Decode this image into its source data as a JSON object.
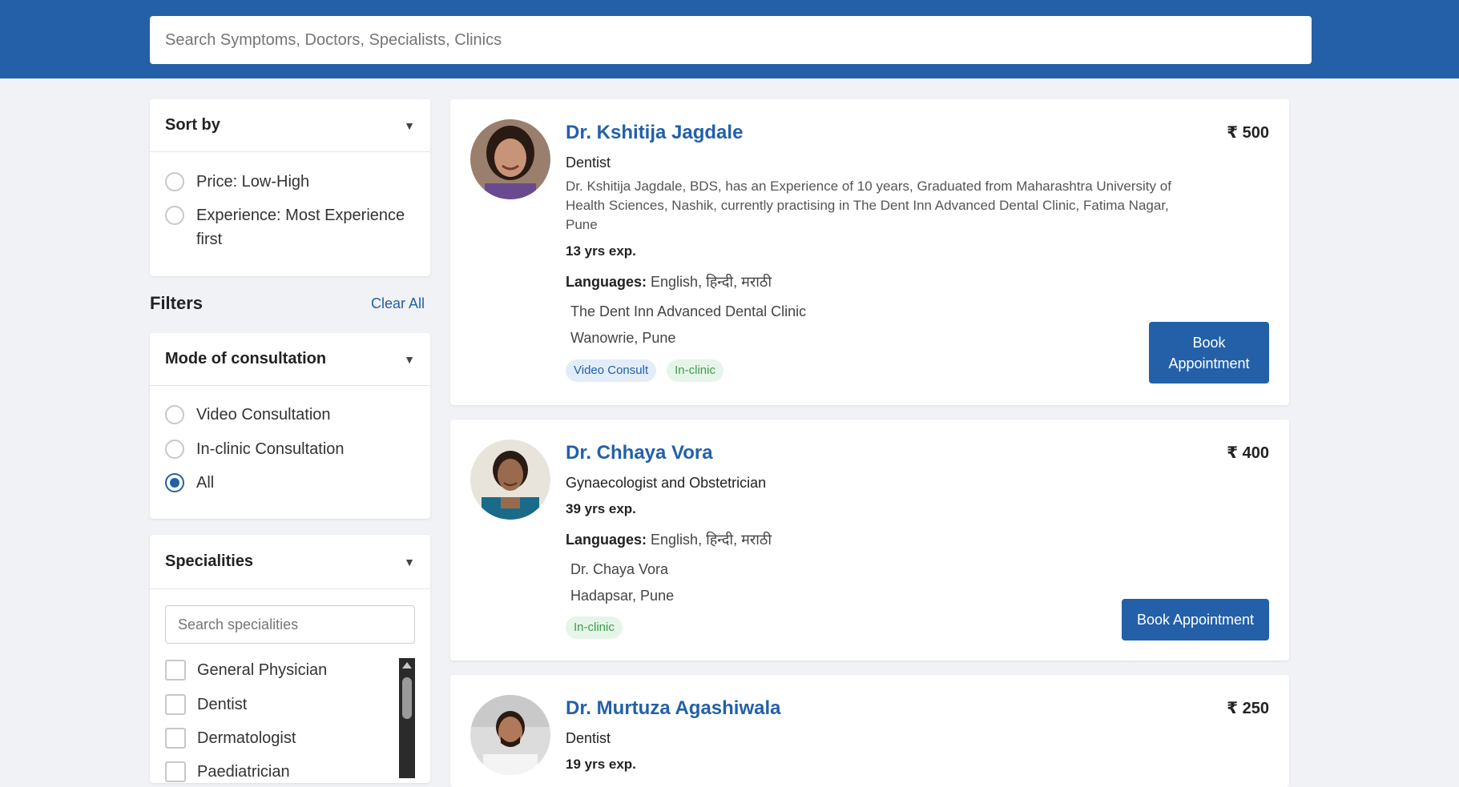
{
  "header": {
    "search_placeholder": "Search Symptoms, Doctors, Specialists, Clinics"
  },
  "sort": {
    "title": "Sort by",
    "options": [
      {
        "label": "Price: Low-High",
        "selected": false
      },
      {
        "label": "Experience: Most Experience first",
        "selected": false
      }
    ]
  },
  "filters": {
    "title": "Filters",
    "clear_all": "Clear All"
  },
  "mode": {
    "title": "Mode of consultation",
    "options": [
      {
        "label": "Video Consultation",
        "selected": false
      },
      {
        "label": "In-clinic Consultation",
        "selected": false
      },
      {
        "label": "All",
        "selected": true
      }
    ]
  },
  "specialities": {
    "title": "Specialities",
    "search_placeholder": "Search specialities",
    "items": [
      {
        "label": "General Physician",
        "checked": false
      },
      {
        "label": "Dentist",
        "checked": false
      },
      {
        "label": "Dermatologist",
        "checked": false
      },
      {
        "label": "Paediatrician",
        "checked": false
      }
    ]
  },
  "doctors": [
    {
      "name": "Dr. Kshitija Jagdale",
      "specialty": "Dentist",
      "description": "Dr. Kshitija Jagdale, BDS, has an Experience of 10 years, Graduated from Maharashtra University of Health Sciences, Nashik, currently practising in The Dent Inn Advanced Dental Clinic, Fatima Nagar, Pune",
      "experience": "13 yrs exp.",
      "languages_label": "Languages:",
      "languages": "English, हिन्दी, मराठी",
      "clinic_name": "The Dent Inn Advanced Dental Clinic",
      "clinic_location": "Wanowrie, Pune",
      "tags": [
        "Video Consult",
        "In-clinic"
      ],
      "price": "₹ 500",
      "button": "Book Appointment"
    },
    {
      "name": "Dr. Chhaya Vora",
      "specialty": "Gynaecologist and Obstetrician",
      "experience": "39 yrs exp.",
      "languages_label": "Languages:",
      "languages": "English, हिन्दी, मराठी",
      "clinic_name": "Dr. Chaya Vora",
      "clinic_location": "Hadapsar, Pune",
      "tags": [
        "In-clinic"
      ],
      "price": "₹ 400",
      "button": "Book Appointment"
    },
    {
      "name": "Dr. Murtuza Agashiwala",
      "specialty": "Dentist",
      "experience": "19 yrs exp.",
      "price": "₹ 250"
    }
  ],
  "colors": {
    "brand": "#2360a8",
    "page_bg": "#f0f2f5",
    "tag_video_bg": "#e3edf9",
    "tag_clinic_bg": "#e6f5e9",
    "tag_clinic_text": "#3d9c4c"
  }
}
